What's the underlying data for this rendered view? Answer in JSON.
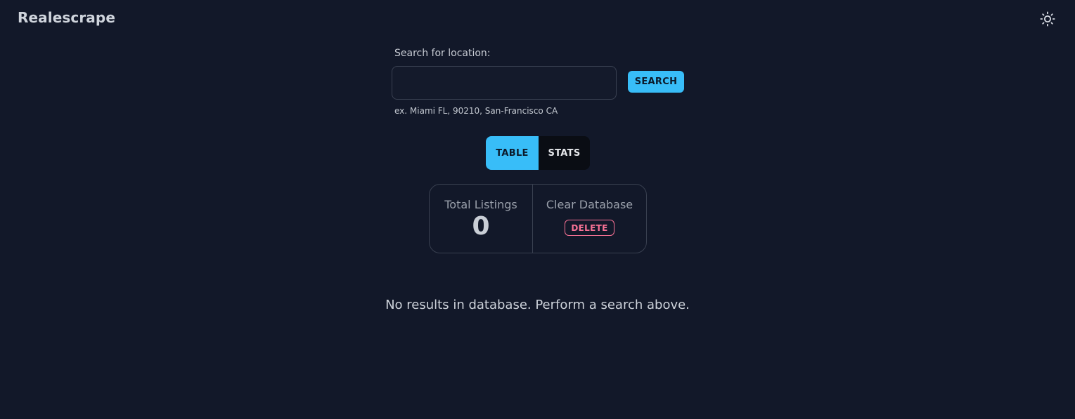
{
  "app": {
    "title": "Realescrape",
    "theme_toggle_icon": "sun-icon"
  },
  "search": {
    "label": "Search for location:",
    "value": "",
    "placeholder": "",
    "hint": "ex. Miami FL, 90210, San-Francisco CA",
    "button_label": "SEARCH"
  },
  "tabs": [
    {
      "label": "TABLE",
      "active": true
    },
    {
      "label": "STATS",
      "active": false
    }
  ],
  "stats": {
    "total_listings_title": "Total Listings",
    "total_listings_value": "0",
    "clear_db_title": "Clear Database",
    "delete_label": "DELETE"
  },
  "main": {
    "empty_message": "No results in database. Perform a search above."
  },
  "colors": {
    "background": "#121829",
    "accent": "#38bdf8",
    "danger": "#f87295"
  }
}
